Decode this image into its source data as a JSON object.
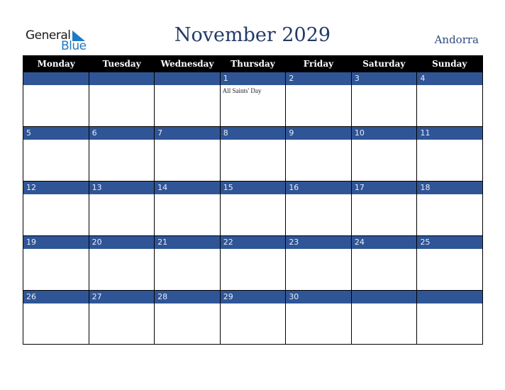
{
  "logo": {
    "word1": "General",
    "word2": "Blue"
  },
  "header": {
    "title": "November 2029",
    "country": "Andorra"
  },
  "colors": {
    "band": "#2f5596",
    "title": "#233a66",
    "header_bg": "#000000",
    "logo_blue": "#1f7ac4"
  },
  "weekdays": [
    "Monday",
    "Tuesday",
    "Wednesday",
    "Thursday",
    "Friday",
    "Saturday",
    "Sunday"
  ],
  "weeks": [
    [
      {
        "day": ""
      },
      {
        "day": ""
      },
      {
        "day": ""
      },
      {
        "day": "1",
        "event": "All Saints' Day"
      },
      {
        "day": "2"
      },
      {
        "day": "3"
      },
      {
        "day": "4"
      }
    ],
    [
      {
        "day": "5"
      },
      {
        "day": "6"
      },
      {
        "day": "7"
      },
      {
        "day": "8"
      },
      {
        "day": "9"
      },
      {
        "day": "10"
      },
      {
        "day": "11"
      }
    ],
    [
      {
        "day": "12"
      },
      {
        "day": "13"
      },
      {
        "day": "14"
      },
      {
        "day": "15"
      },
      {
        "day": "16"
      },
      {
        "day": "17"
      },
      {
        "day": "18"
      }
    ],
    [
      {
        "day": "19"
      },
      {
        "day": "20"
      },
      {
        "day": "21"
      },
      {
        "day": "22"
      },
      {
        "day": "23"
      },
      {
        "day": "24"
      },
      {
        "day": "25"
      }
    ],
    [
      {
        "day": "26"
      },
      {
        "day": "27"
      },
      {
        "day": "28"
      },
      {
        "day": "29"
      },
      {
        "day": "30"
      },
      {
        "day": ""
      },
      {
        "day": ""
      }
    ]
  ]
}
